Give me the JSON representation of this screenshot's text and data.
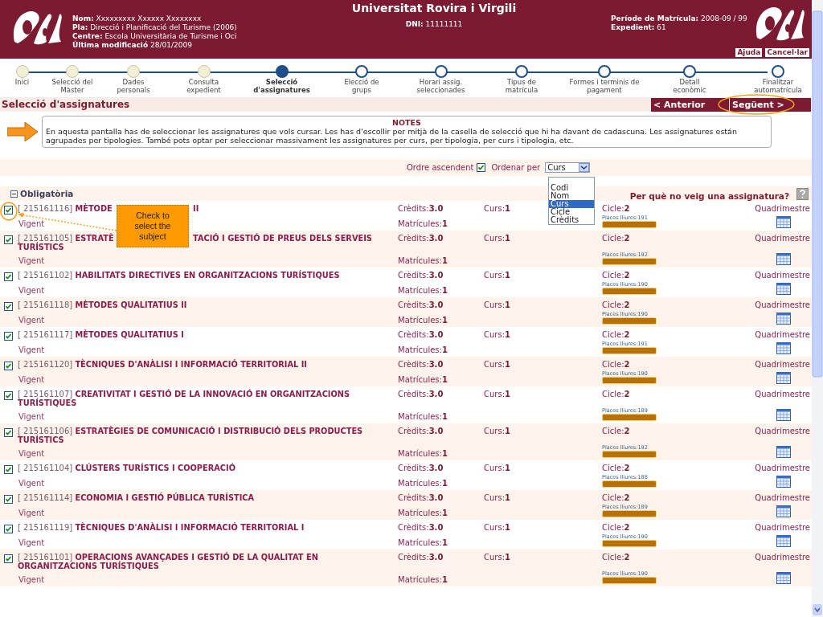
{
  "header": {
    "university": "Universitat Rovira i Virgili",
    "left_fields": [
      {
        "label": "Nom:",
        "value": "Xxxxxxxxx Xxxxxx Xxxxxxxx"
      },
      {
        "label": "Pla:",
        "value": "Direcció i Planificació del Turisme (2006)"
      },
      {
        "label": "Centre:",
        "value": "Escola Universitària de Turisme i Oci"
      },
      {
        "label": "Última modificació",
        "value": "28/01/2009"
      }
    ],
    "center_fields": [
      {
        "label": "DNI:",
        "value": "11111111"
      }
    ],
    "right_fields": [
      {
        "label": "Període de Matrícula:",
        "value": "2008-09 / 99"
      },
      {
        "label": "Expedient:",
        "value": "61"
      }
    ],
    "buttons": [
      "Ajuda",
      "Cancel·lar"
    ]
  },
  "steps": [
    {
      "label": "Inici",
      "completed": true,
      "selected": false
    },
    {
      "label": "Selecció del\nMàster",
      "completed": true,
      "selected": false
    },
    {
      "label": "Dades\npersonals",
      "completed": true,
      "selected": false
    },
    {
      "label": "Consulta\nexpedient",
      "completed": true,
      "selected": false
    },
    {
      "label": "Selecció\nd'assignatures",
      "completed": false,
      "selected": true
    },
    {
      "label": "Elecció de\ngrups",
      "completed": false,
      "selected": false
    },
    {
      "label": "Horari assig.\nseleccionades",
      "completed": false,
      "selected": false
    },
    {
      "label": "Tipus de\nmatrícula",
      "completed": false,
      "selected": false
    },
    {
      "label": "Formes i terminis de\npagament",
      "completed": false,
      "selected": false
    },
    {
      "label": "Detall\neconòmic",
      "completed": false,
      "selected": false
    },
    {
      "label": "Finalitzar\nautomatrícula",
      "completed": false,
      "selected": false
    }
  ],
  "page_title": "Selecció d'assignatures",
  "nav_buttons": [
    "< Anterior",
    "Següent >"
  ],
  "notes": {
    "title": "NOTES",
    "text": "En aquesta pantalla has de seleccionar les assignatures que vols cursar. Les has d'escollir per mitjà de la casella de selecció que hi ha davant de cadascuna. Les assignatures están agrupades per tipologies. També pots optar per seleccionar massivament les assignatures per curs, per tipologia, per curs i tipologia, etc."
  },
  "sort": {
    "ascending_label": "Ordre ascendent",
    "ascending": true,
    "order_label": "Ordenar per",
    "value": "Curs",
    "options": [
      {
        "label": "Codi",
        "selected": false
      },
      {
        "label": "Nom",
        "selected": false
      },
      {
        "label": "Curs",
        "selected": true
      },
      {
        "label": "Cicle",
        "selected": false
      },
      {
        "label": "Crèdits",
        "selected": false
      }
    ]
  },
  "group": {
    "title": "Obligatòria",
    "expanded": true,
    "help_link": "Per què no veig una assignatura?"
  },
  "callout": {
    "text": "Check to select the subject"
  },
  "subjects": [
    {
      "checked": true,
      "code": "[ 215161116]",
      "title_parts": [
        "MÈTODE",
        "II"
      ],
      "status": "Vigent",
      "credits": "Crèdits:**3.0**",
      "enrolments": "Matrícules:**1**",
      "course": "Curs:**1**",
      "cycle": "Cicle:**2**",
      "places": "Places lliures:191",
      "term": "Quadrimestre"
    },
    {
      "checked": true,
      "code": "[ 215161105]",
      "title_parts": [
        "ESTRATÈ",
        "TACIÓ I GESTIÓ DE PREUS DELS SERVEIS",
        "TURÍSTICS"
      ],
      "status": "Vigent",
      "credits": "Crèdits:**3.0**",
      "enrolments": "Matrícules:**1**",
      "course": "Curs:**1**",
      "cycle": "Cicle:**2**",
      "places": "Places lliures:192",
      "term": "Quadrimestre"
    },
    {
      "checked": true,
      "code": "[ 215161102]",
      "title_parts": [
        "HABILITATS DIRECTIVES EN ORGANITZACIONS TURÍSTIQUES"
      ],
      "status": "Vigent",
      "credits": "Crèdits:**3.0**",
      "enrolments": "Matrícules:**1**",
      "course": "Curs:**1**",
      "cycle": "Cicle:**2**",
      "places": "Places lliures:190",
      "term": "Quadrimestre"
    },
    {
      "checked": true,
      "code": "[ 215161118]",
      "title_parts": [
        "MÈTODES QUALITATIUS II"
      ],
      "status": "Vigent",
      "credits": "Crèdits:**3.0**",
      "enrolments": "Matrícules:**1**",
      "course": "Curs:**1**",
      "cycle": "Cicle:**2**",
      "places": "Places lliures:190",
      "term": "Quadrimestre"
    },
    {
      "checked": true,
      "code": "[ 215161117]",
      "title_parts": [
        "MÈTODES QUALITATIUS I"
      ],
      "status": "Vigent",
      "credits": "Crèdits:**3.0**",
      "enrolments": "Matrícules:**1**",
      "course": "Curs:**1**",
      "cycle": "Cicle:**2**",
      "places": "Places lliures:191",
      "term": "Quadrimestre"
    },
    {
      "checked": true,
      "code": "[ 215161120]",
      "title_parts": [
        "TÈCNIQUES D'ANÀLISI I INFORMACIÓ TERRITORIAL II"
      ],
      "status": "Vigent",
      "credits": "Crèdits:**3.0**",
      "enrolments": "Matrícules:**1**",
      "course": "Curs:**1**",
      "cycle": "Cicle:**2**",
      "places": "Places lliures:190",
      "term": "Quadrimestre"
    },
    {
      "checked": true,
      "code": "[ 215161107]",
      "title_parts": [
        "CREATIVITAT I GESTIÓ DE LA INNOVACIÓ EN ORGANITZACIONS TURÍSTIQUES"
      ],
      "status": "Vigent",
      "credits": "Crèdits:**3.0**",
      "enrolments": "Matrícules:**1**",
      "course": "Curs:**1**",
      "cycle": "Cicle:**2**",
      "places": "Places lliures:189",
      "term": "Quadrimestre"
    },
    {
      "checked": true,
      "code": "[ 215161106]",
      "title_parts": [
        "ESTRATÈGIES DE COMUNICACIÓ I DISTRIBUCIÓ DELS PRODUCTES TURÍSTICS"
      ],
      "status": "Vigent",
      "credits": "Crèdits:**3.0**",
      "enrolments": "Matrícules:**1**",
      "course": "Curs:**1**",
      "cycle": "Cicle:**2**",
      "places": "Places lliures:192",
      "term": "Quadrimestre"
    },
    {
      "checked": true,
      "code": "[ 215161104]",
      "title_parts": [
        "CLÚSTERS TURÍSTICS I COOPERACIÓ"
      ],
      "status": "Vigent",
      "credits": "Crèdits:**3.0**",
      "enrolments": "Matrícules:**1**",
      "course": "Curs:**1**",
      "cycle": "Cicle:**2**",
      "places": "Places lliures:188",
      "term": "Quadrimestre"
    },
    {
      "checked": true,
      "code": "[ 215161114]",
      "title_parts": [
        "ECONOMIA I GESTIÓ PÚBLICA TURÍSTICA"
      ],
      "status": "Vigent",
      "credits": "Crèdits:**3.0**",
      "enrolments": "Matrícules:**1**",
      "course": "Curs:**1**",
      "cycle": "Cicle:**2**",
      "places": "Places lliures:189",
      "term": "Quadrimestre"
    },
    {
      "checked": true,
      "code": "[ 215161119]",
      "title_parts": [
        "TÈCNIQUES D'ANÀLISI I INFORMACIÓ TERRITORIAL I"
      ],
      "status": "Vigent",
      "credits": "Crèdits:**3.0**",
      "enrolments": "Matrícules:**1**",
      "course": "Curs:**1**",
      "cycle": "Cicle:**2**",
      "places": "Places lliures:190",
      "term": "Quadrimestre"
    },
    {
      "checked": true,
      "code": "[ 215161101]",
      "title_parts": [
        "OPERACIONS AVANÇADES I GESTIÓ DE LA QUALITAT EN ORGANITZACIONS TURÍSTIQUES"
      ],
      "status": "Vigent",
      "credits": "Crèdits:**3.0**",
      "enrolments": "Matrícules:**1**",
      "course": "Curs:**1**",
      "cycle": "Cicle:**2**",
      "places": "Places lliures:190",
      "term": "Quadrimestre"
    }
  ]
}
